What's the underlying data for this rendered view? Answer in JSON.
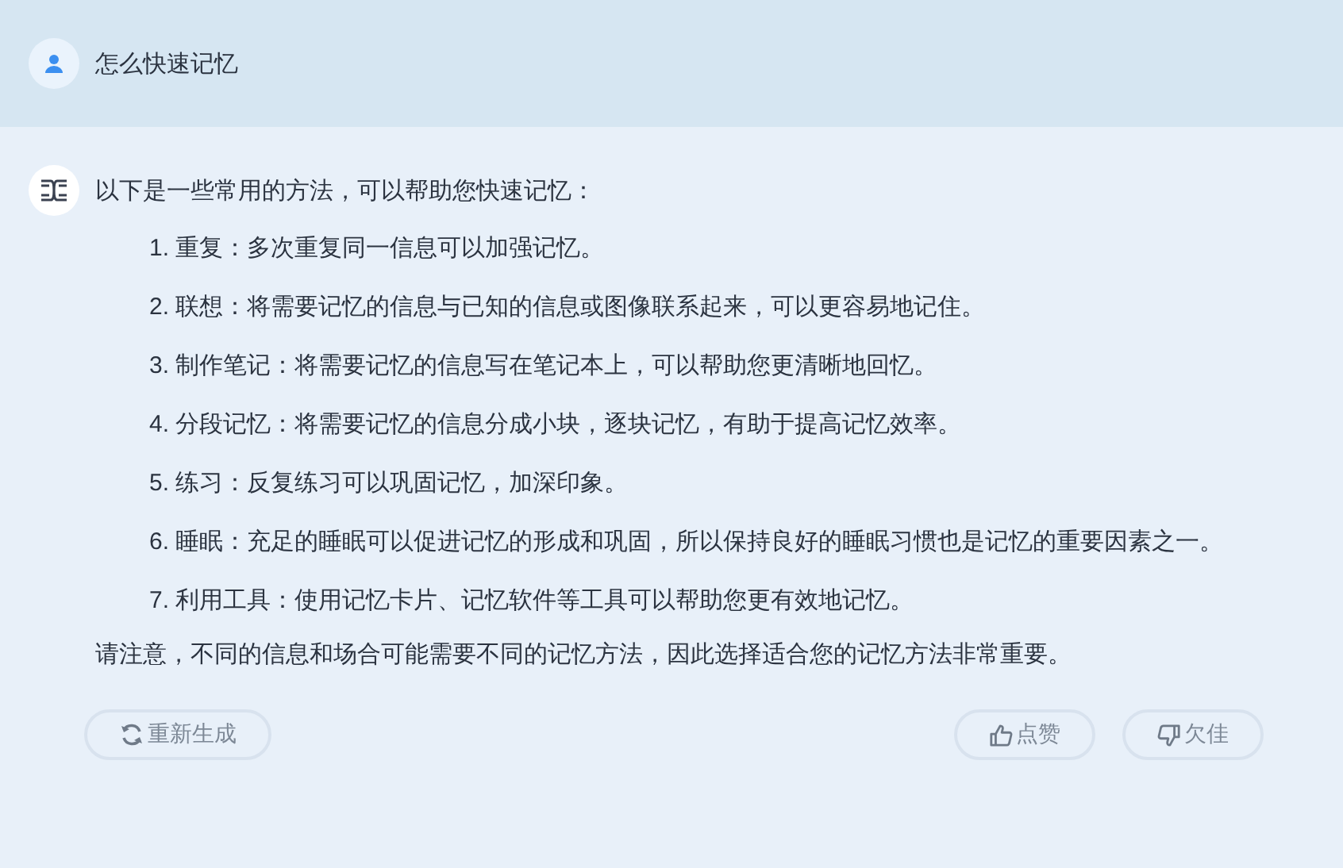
{
  "question": {
    "text": "怎么快速记忆"
  },
  "answer": {
    "intro": "以下是一些常用的方法，可以帮助您快速记忆：",
    "items": [
      {
        "number": "1.",
        "text": "重复：多次重复同一信息可以加强记忆。"
      },
      {
        "number": "2.",
        "text": "联想：将需要记忆的信息与已知的信息或图像联系起来，可以更容易地记住。"
      },
      {
        "number": "3.",
        "text": "制作笔记：将需要记忆的信息写在笔记本上，可以帮助您更清晰地回忆。"
      },
      {
        "number": "4.",
        "text": "分段记忆：将需要记忆的信息分成小块，逐块记忆，有助于提高记忆效率。"
      },
      {
        "number": "5.",
        "text": "练习：反复练习可以巩固记忆，加深印象。"
      },
      {
        "number": "6.",
        "text": "睡眠：充足的睡眠可以促进记忆的形成和巩固，所以保持良好的睡眠习惯也是记忆的重要因素之一。"
      },
      {
        "number": "7.",
        "text": "利用工具：使用记忆卡片、记忆软件等工具可以帮助您更有效地记忆。"
      }
    ],
    "note": "请注意，不同的信息和场合可能需要不同的记忆方法，因此选择适合您的记忆方法非常重要。"
  },
  "actions": [
    {
      "kind": "regenerate",
      "label": "重新生成"
    },
    {
      "kind": "like",
      "label": "点赞"
    },
    {
      "kind": "dislike",
      "label": "欠佳"
    }
  ]
}
